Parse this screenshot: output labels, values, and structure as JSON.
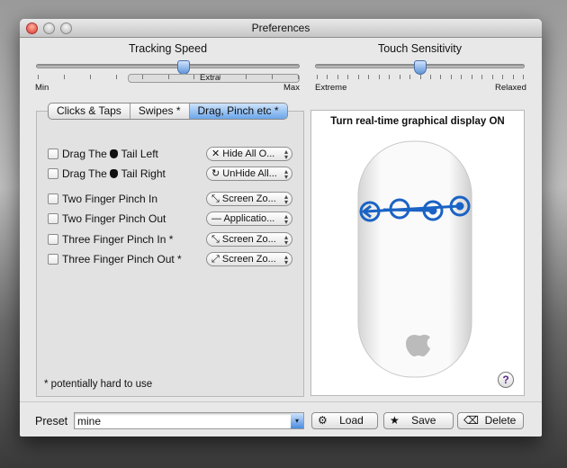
{
  "window": {
    "title": "Preferences"
  },
  "tracking": {
    "label": "Tracking Speed",
    "min": "Min",
    "max": "Max",
    "extra": "Extra",
    "value_fraction": 0.56
  },
  "touch": {
    "label": "Touch Sensitivity",
    "min": "Extreme",
    "max": "Relaxed",
    "value_fraction": 0.5
  },
  "tabs": [
    {
      "label": "Clicks & Taps"
    },
    {
      "label": "Swipes *"
    },
    {
      "label": "Drag, Pinch etc *",
      "selected": true
    }
  ],
  "gestures": [
    {
      "label_pre": "Drag The",
      "label_post": "Tail Left",
      "apple": true,
      "checked": false,
      "action": "Hide All O...",
      "icon": "x-icon"
    },
    {
      "label_pre": "Drag The",
      "label_post": "Tail Right",
      "apple": true,
      "checked": false,
      "action": "UnHide All...",
      "icon": "refresh-icon"
    },
    {
      "label_pre": "Two Finger Pinch In",
      "label_post": "",
      "checked": false,
      "action": "Screen Zo...",
      "icon": "zoom-in-icon"
    },
    {
      "label_pre": "Two Finger Pinch Out",
      "label_post": "",
      "checked": false,
      "action": "Applicatio...",
      "icon": "dash-icon"
    },
    {
      "label_pre": "Three Finger Pinch In *",
      "label_post": "",
      "checked": false,
      "action": "Screen Zo...",
      "icon": "zoom-in-icon"
    },
    {
      "label_pre": "Three Finger Pinch Out *",
      "label_post": "",
      "checked": false,
      "action": "Screen Zo...",
      "icon": "zoom-out-icon"
    }
  ],
  "footnote": "* potentially hard to use",
  "display": {
    "toggle_label": "Turn real-time graphical display ON",
    "help": "?"
  },
  "preset": {
    "label": "Preset",
    "value": "mine"
  },
  "buttons": {
    "load": "Load",
    "save": "Save",
    "delete": "Delete"
  },
  "glyphs": {
    "x-icon": "✕",
    "refresh-icon": "↻",
    "zoom-in-icon": "⤡",
    "dash-icon": "—",
    "zoom-out-icon": "⤢",
    "gear": "⚙",
    "star": "★",
    "del": "⌫"
  }
}
